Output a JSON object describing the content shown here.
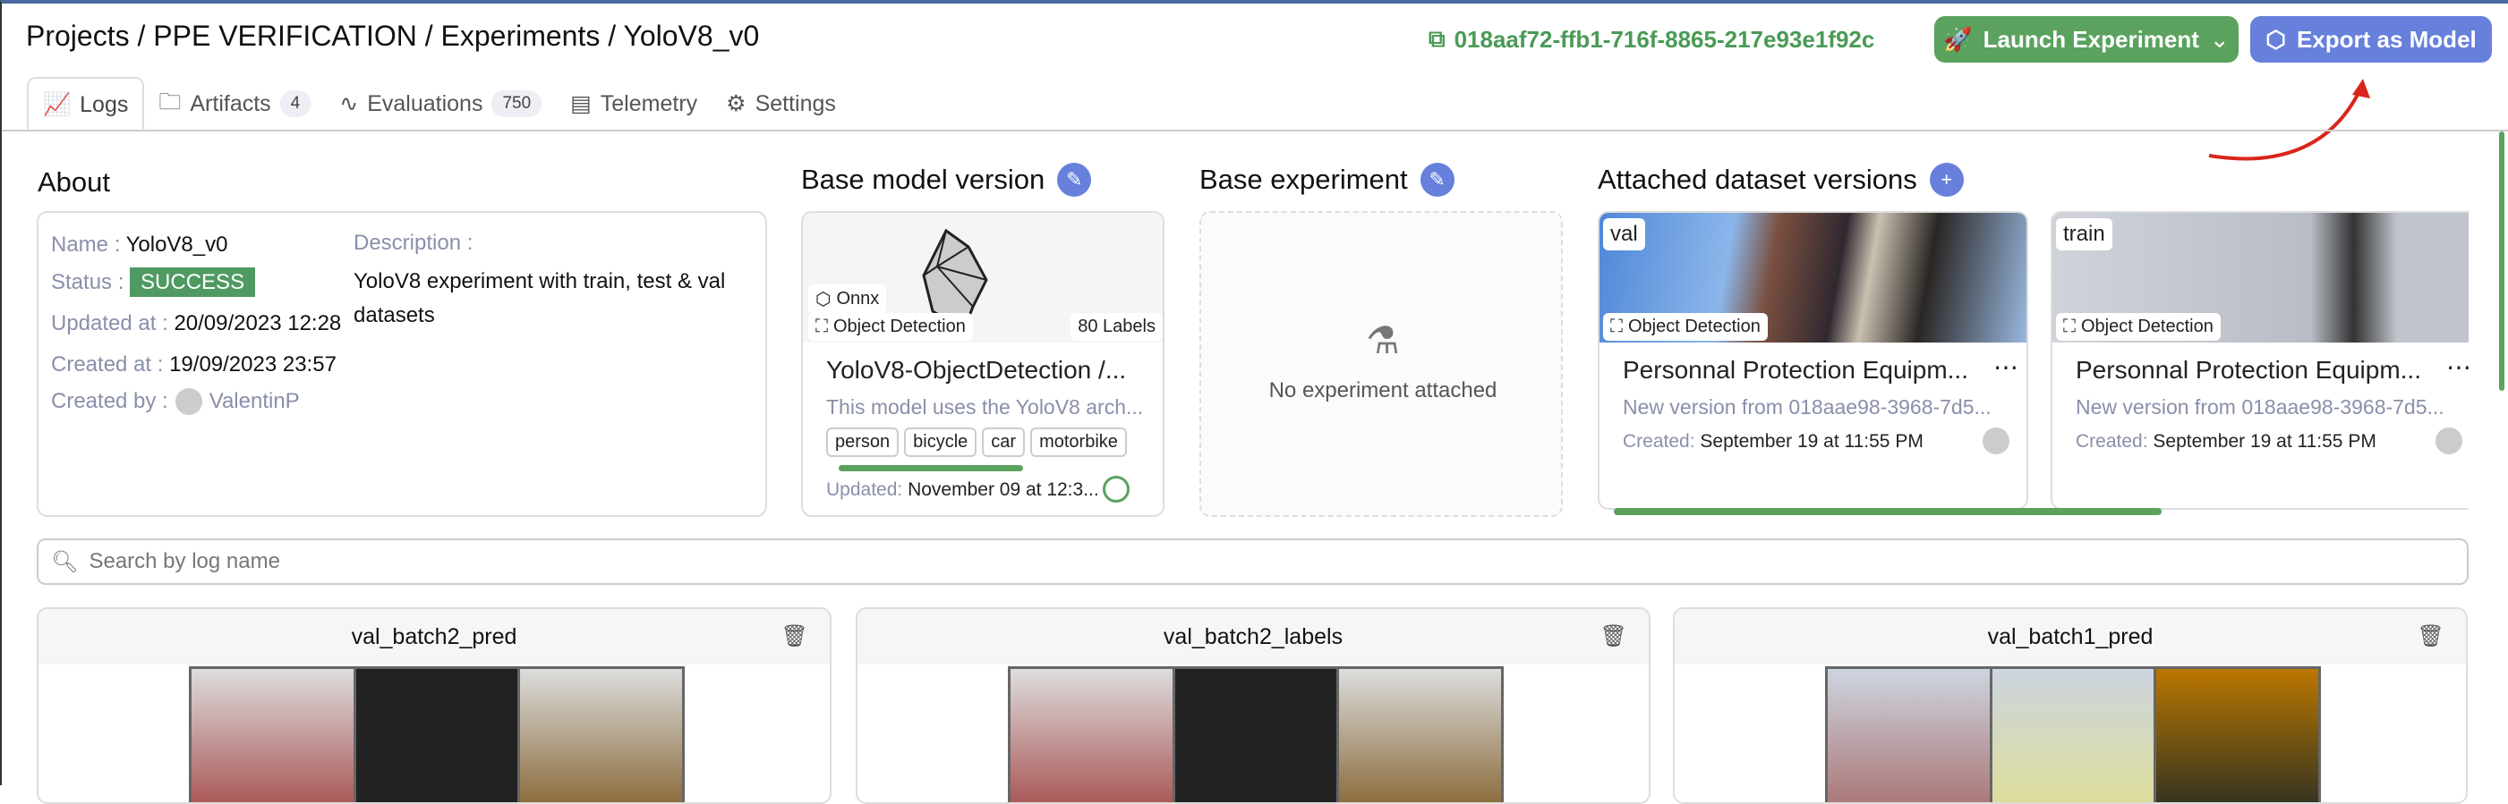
{
  "breadcrumb": "Projects / PPE VERIFICATION / Experiments / YoloV8_v0",
  "tabs": [
    {
      "label": "Logs"
    },
    {
      "label": "Artifacts",
      "count": "4"
    },
    {
      "label": "Evaluations",
      "count": "750"
    },
    {
      "label": "Telemetry"
    },
    {
      "label": "Settings"
    }
  ],
  "header": {
    "experiment_id": "018aaf72-ffb1-716f-8865-217e93e1f92c",
    "launch_label": "Launch Experiment",
    "export_label": "Export as Model"
  },
  "about": {
    "heading": "About",
    "name_label": "Name :",
    "name": "YoloV8_v0",
    "status_label": "Status :",
    "status": "SUCCESS",
    "updated_label": "Updated at :",
    "updated": "20/09/2023 12:28",
    "created_label": "Created at :",
    "created": "19/09/2023 23:57",
    "by_label": "Created by :",
    "by": "ValentinP",
    "desc_label": "Description :",
    "desc": "YoloV8 experiment with train, test & val datasets"
  },
  "base_model": {
    "heading": "Base model version",
    "framework": "Onnx",
    "task": "Object Detection",
    "labels_count": "80 Labels",
    "title": "YoloV8-ObjectDetection /...",
    "description": "This model uses the YoloV8 arch...",
    "tags": [
      "person",
      "bicycle",
      "car",
      "motorbike"
    ],
    "updated_label": "Updated:",
    "updated": "November 09 at 12:3..."
  },
  "base_experiment": {
    "heading": "Base experiment",
    "empty": "No experiment attached"
  },
  "datasets": {
    "heading": "Attached dataset versions",
    "items": [
      {
        "split": "val",
        "task": "Object Detection",
        "title": "Personnal Protection Equipm...",
        "sub": "New version from 018aae98-3968-7d5...",
        "created_label": "Created:",
        "created": "September 19 at 11:55 PM"
      },
      {
        "split": "train",
        "task": "Object Detection",
        "title": "Personnal Protection Equipm...",
        "sub": "New version from 018aae98-3968-7d5...",
        "created_label": "Created:",
        "created": "September 19 at 11:55 PM"
      }
    ]
  },
  "search": {
    "placeholder": "Search by log name"
  },
  "logs": [
    {
      "name": "val_batch2_pred"
    },
    {
      "name": "val_batch2_labels"
    },
    {
      "name": "val_batch1_pred"
    }
  ],
  "colors": {
    "success": "#4f9a62",
    "accent": "#6680dc",
    "launch": "#5aa25e",
    "annotation_arrow": "#d9261c"
  }
}
